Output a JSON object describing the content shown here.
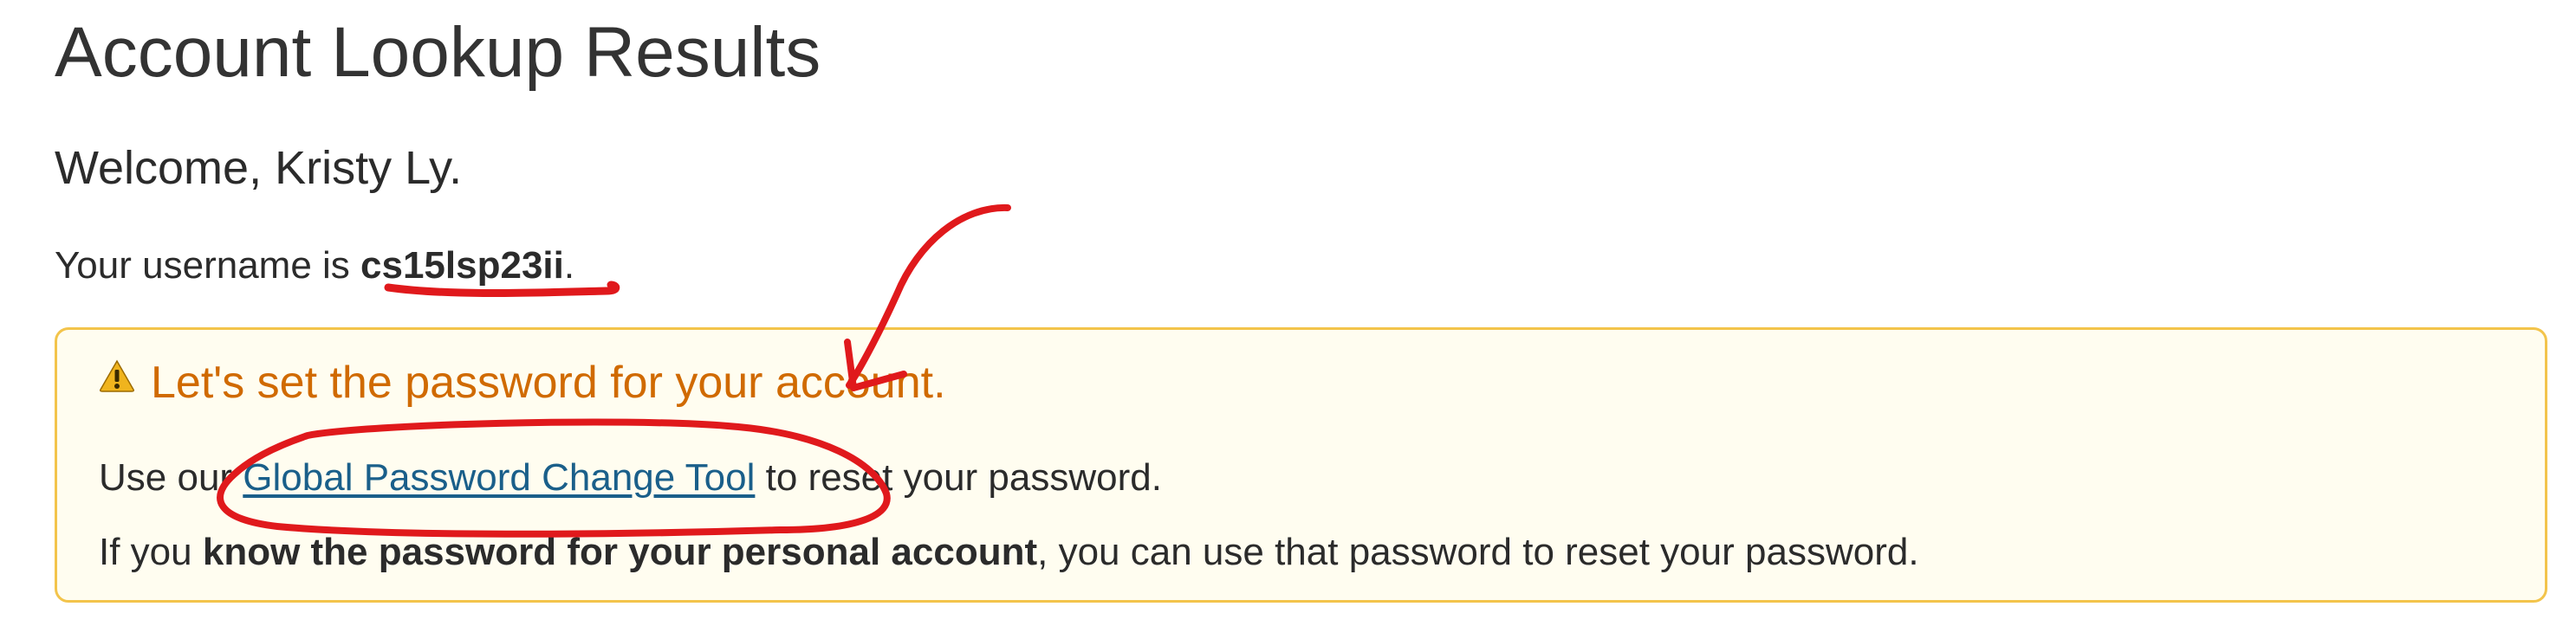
{
  "page": {
    "title": "Account Lookup Results",
    "welcome": "Welcome, Kristy Ly.",
    "username_prefix": "Your username is ",
    "username_value": "cs15lsp23ii",
    "username_suffix": "."
  },
  "alert": {
    "icon": "warning-icon",
    "heading": "Let's set the password for your account.",
    "line1_prefix": "Use our ",
    "link_label": "Global Password Change Tool",
    "line1_suffix": " to reset your password.",
    "line2_prefix": "If you ",
    "line2_bold": "know the password for your personal account",
    "line2_suffix": ", you can use that password to reset your password."
  },
  "annotations": {
    "color": "#e0191c",
    "marks": [
      "username-underline",
      "arrow",
      "link-circle"
    ]
  },
  "colors": {
    "text": "#2b2b2b",
    "alert_heading": "#d06a00",
    "alert_border": "#f3c44b",
    "alert_background": "#fffdf0",
    "link": "#1a5f8a"
  }
}
